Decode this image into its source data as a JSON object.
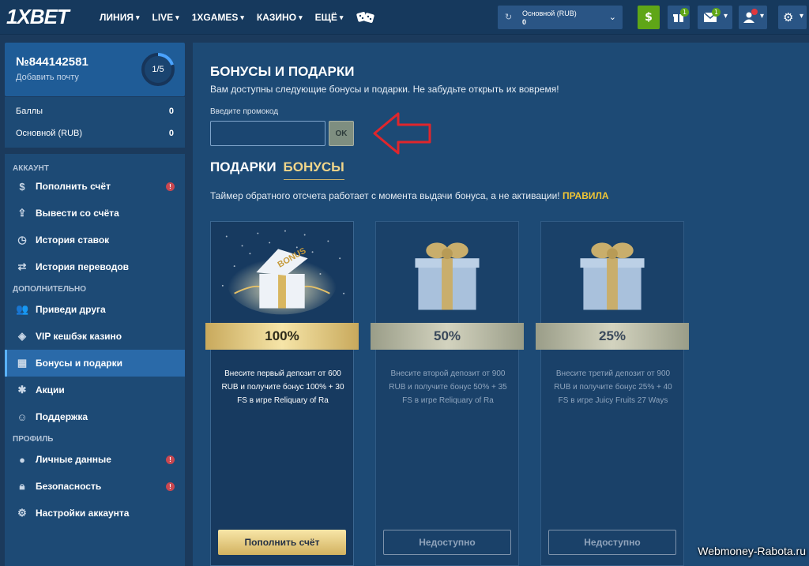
{
  "header": {
    "logo": "1XBET",
    "nav": [
      {
        "label": "ЛИНИЯ"
      },
      {
        "label": "LIVE"
      },
      {
        "label": "1XGAMES"
      },
      {
        "label": "КАЗИНО"
      },
      {
        "label": "ЕЩЁ"
      }
    ],
    "balance": {
      "title": "Основной (RUB)",
      "amount": "0"
    },
    "gift_badge": "1",
    "mail_badge": "1"
  },
  "account": {
    "number": "№844142581",
    "add_email": "Добавить почту",
    "progress": "1/5",
    "progress_fraction": 0.2
  },
  "balances": [
    {
      "label": "Баллы",
      "value": "0"
    },
    {
      "label": "Основной (RUB)",
      "value": "0"
    }
  ],
  "menu": {
    "section_account": "АККАУНТ",
    "section_extra": "ДОПОЛНИТЕЛЬНО",
    "section_profile": "ПРОФИЛЬ",
    "items": [
      {
        "label": "Пополнить счёт",
        "icon": "dollar-icon"
      },
      {
        "label": "Вывести со счёта",
        "icon": "upload-icon"
      },
      {
        "label": "История ставок",
        "icon": "history-icon"
      },
      {
        "label": "История переводов",
        "icon": "transfer-icon"
      },
      {
        "label": "Приведи друга",
        "icon": "users-icon"
      },
      {
        "label": "VIP кешбэк казино",
        "icon": "vip-icon"
      },
      {
        "label": "Бонусы и подарки",
        "icon": "gift-icon"
      },
      {
        "label": "Акции",
        "icon": "promo-icon"
      },
      {
        "label": "Поддержка",
        "icon": "support-icon"
      },
      {
        "label": "Личные данные",
        "icon": "user-icon"
      },
      {
        "label": "Безопасность",
        "icon": "lock-icon"
      },
      {
        "label": "Настройки аккаунта",
        "icon": "gear-icon"
      }
    ],
    "alert": "!"
  },
  "main": {
    "title": "БОНУСЫ И ПОДАРКИ",
    "subtitle": "Вам доступны следующие бонусы и подарки. Не забудьте открыть их вовремя!",
    "promo_label": "Введите промокод",
    "promo_value": "",
    "ok": "OK",
    "tab_gifts": "ПОДАРКИ",
    "tab_bonuses": "БОНУСЫ",
    "timer_text": "Таймер обратного отсчета работает с момента выдачи бонуса, а не активации!",
    "rules": "ПРАВИЛА",
    "cards": [
      {
        "percent": "100%",
        "text": "Внесите первый депозит от 600 RUB и получите бонус 100% + 30 FS в игре Reliquary of Ra",
        "button": "Пополнить счёт",
        "available": true
      },
      {
        "percent": "50%",
        "text": "Внесите второй депозит от 900 RUB и получите бонус 50% + 35 FS в игре Reliquary of Ra",
        "button": "Недоступно",
        "available": false
      },
      {
        "percent": "25%",
        "text": "Внесите третий депозит от 900 RUB и получите бонус 25% + 40 FS в игре Juicy Fruits 27 Ways",
        "button": "Недоступно",
        "available": false
      }
    ]
  },
  "watermark": "Webmoney-Rabota.ru",
  "colors": {
    "header": "#16395d",
    "sidebar": "#1d4a75",
    "active": "#2a6aa9",
    "gold": "#f0c534",
    "green": "#5fa617"
  }
}
